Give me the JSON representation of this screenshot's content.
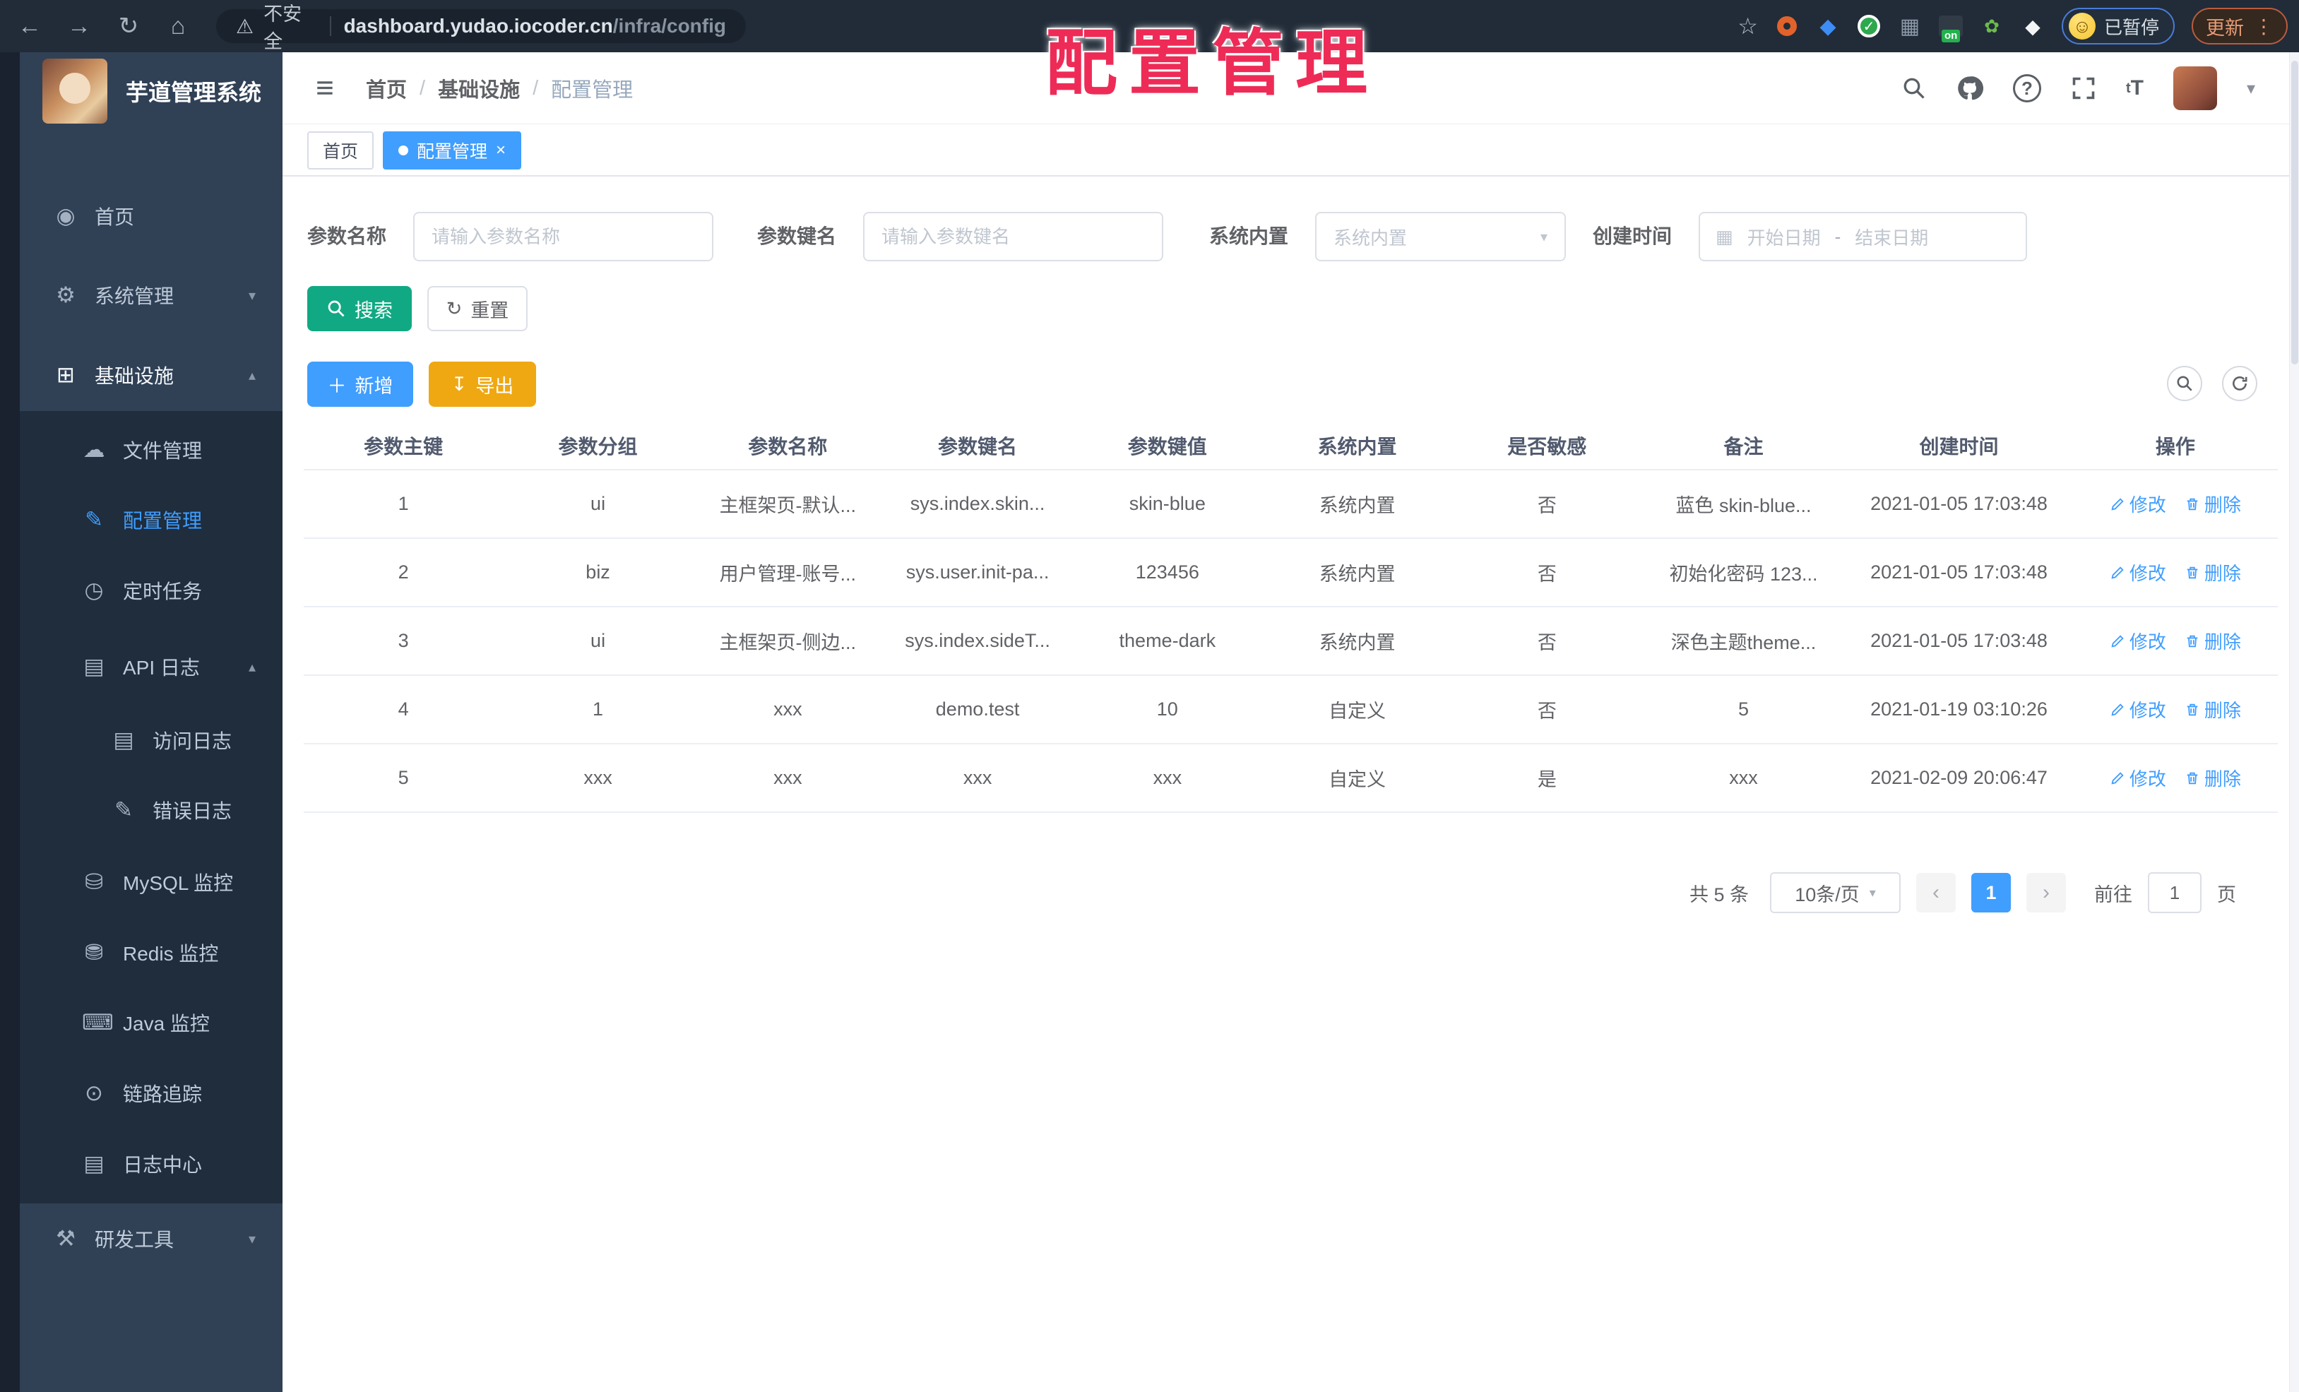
{
  "browser": {
    "back": "←",
    "forward": "→",
    "reload": "↻",
    "home": "⌂",
    "warning_icon": "⚠",
    "security_label": "不安全",
    "url_host": "dashboard.yudao.iocoder.cn",
    "url_path": "/infra/config",
    "bookmark_star": "☆",
    "paused_label": "已暂停",
    "update_label": "更新",
    "kebab": "⋮"
  },
  "watermark": "配置管理",
  "sidebar": {
    "title": "芋道管理系统",
    "items": [
      {
        "label": "首页",
        "icon": "◉"
      },
      {
        "label": "系统管理",
        "icon": "⚙",
        "chevron": "▾"
      },
      {
        "label": "基础设施",
        "icon": "⊞",
        "chevron": "▴"
      },
      {
        "label": "文件管理",
        "icon": "☁"
      },
      {
        "label": "配置管理",
        "icon": "✎"
      },
      {
        "label": "定时任务",
        "icon": "◷"
      },
      {
        "label": "API 日志",
        "icon": "▤",
        "chevron": "▴"
      },
      {
        "label": "访问日志",
        "icon": "▤"
      },
      {
        "label": "错误日志",
        "icon": "✎"
      },
      {
        "label": "MySQL 监控",
        "icon": "⛁"
      },
      {
        "label": "Redis 监控",
        "icon": "⛃"
      },
      {
        "label": "Java 监控",
        "icon": "⌨"
      },
      {
        "label": "链路追踪",
        "icon": "⊙"
      },
      {
        "label": "日志中心",
        "icon": "▤"
      },
      {
        "label": "研发工具",
        "icon": "⚒",
        "chevron": "▾"
      }
    ]
  },
  "header": {
    "hamburger": "≡",
    "breadcrumb": [
      "首页",
      "基础设施",
      "配置管理"
    ],
    "separator": "/",
    "font_icon": "tT",
    "caret": "▾"
  },
  "tags": {
    "home": "首页",
    "active": "配置管理",
    "close": "×"
  },
  "filters": {
    "name_label": "参数名称",
    "name_placeholder": "请输入参数名称",
    "key_label": "参数键名",
    "key_placeholder": "请输入参数键名",
    "type_label": "系统内置",
    "type_placeholder": "系统内置",
    "date_label": "创建时间",
    "date_start": "开始日期",
    "date_sep": "-",
    "date_end": "结束日期"
  },
  "actions": {
    "search": "搜索",
    "reset": "重置",
    "reset_icon": "↻",
    "add": "新增",
    "add_icon": "＋",
    "export": "导出",
    "export_icon": "↧"
  },
  "table": {
    "columns": [
      "参数主键",
      "参数分组",
      "参数名称",
      "参数键名",
      "参数键值",
      "系统内置",
      "是否敏感",
      "备注",
      "创建时间",
      "操作"
    ],
    "rows": [
      [
        "1",
        "ui",
        "主框架页-默认...",
        "sys.index.skin...",
        "skin-blue",
        "系统内置",
        "否",
        "蓝色 skin-blue...",
        "2021-01-05 17:03:48"
      ],
      [
        "2",
        "biz",
        "用户管理-账号...",
        "sys.user.init-pa...",
        "123456",
        "系统内置",
        "否",
        "初始化密码 123...",
        "2021-01-05 17:03:48"
      ],
      [
        "3",
        "ui",
        "主框架页-侧边...",
        "sys.index.sideT...",
        "theme-dark",
        "系统内置",
        "否",
        "深色主题theme...",
        "2021-01-05 17:03:48"
      ],
      [
        "4",
        "1",
        "xxx",
        "demo.test",
        "10",
        "自定义",
        "否",
        "5",
        "2021-01-19 03:10:26"
      ],
      [
        "5",
        "xxx",
        "xxx",
        "xxx",
        "xxx",
        "自定义",
        "是",
        "xxx",
        "2021-02-09 20:06:47"
      ]
    ],
    "edit_label": "修改",
    "delete_label": "删除"
  },
  "pagination": {
    "total": "共 5 条",
    "page_size": "10条/页",
    "prev": "‹",
    "current": "1",
    "next": "›",
    "goto_label": "前往",
    "goto_value": "1",
    "page_unit": "页"
  },
  "colors": {
    "accent_blue": "#409EFF",
    "search_teal": "#11A983",
    "export_amber": "#EFA812",
    "sidebar_bg": "#304156",
    "submenu_bg": "#1F2D3D",
    "watermark_red": "#EE2B56"
  }
}
